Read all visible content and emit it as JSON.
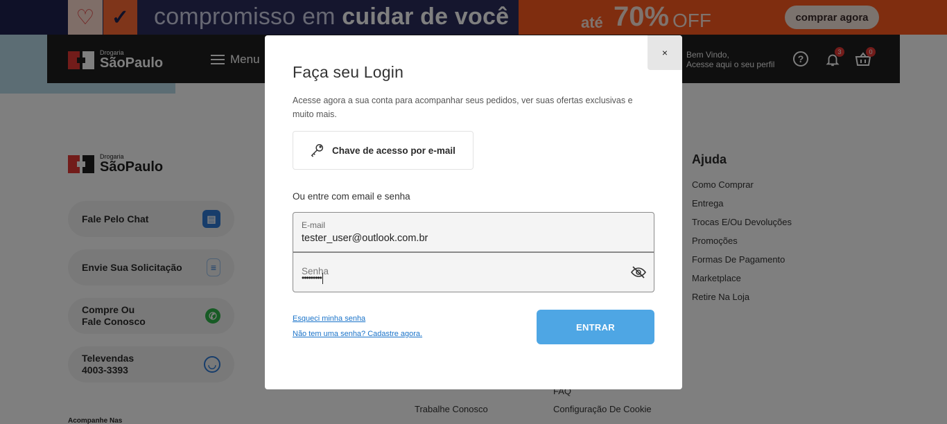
{
  "promo": {
    "headline_light": "compromisso em",
    "headline_bold": "cuidar de você",
    "up_to": "até",
    "percent": "70%",
    "off": "OFF",
    "cta": "comprar agora"
  },
  "header": {
    "brand_small": "Drogaria",
    "brand_name": "SãoPaulo",
    "menu_label": "Menu",
    "welcome_line1": "Bem Vindo,",
    "welcome_line2": "Acesse aqui o seu perfil",
    "notifications_count": "3",
    "cart_count": "0"
  },
  "sidebar": {
    "brand_small": "Drogaria",
    "brand_name": "SãoPaulo",
    "contacts": [
      {
        "line1": "Fale Pelo Chat",
        "line2": ""
      },
      {
        "line1": "Envie Sua Solicitação",
        "line2": ""
      },
      {
        "line1": "Compre Ou",
        "line2": "Fale Conosco"
      },
      {
        "line1": "Televendas",
        "line2": "4003-3393"
      }
    ],
    "follow_label": "Acompanhe Nas"
  },
  "help": {
    "title": "Ajuda",
    "links": [
      "Como Comprar",
      "Entrega",
      "Trocas E/Ou Devoluções",
      "Promoções",
      "Formas De Pagamento",
      "Marketplace",
      "Retire Na Loja"
    ]
  },
  "footer": {
    "faq": "FAQ",
    "work_with_us": "Trabalhe Conosco",
    "cookie_config": "Configuração De Cookie"
  },
  "login_modal": {
    "close_label": "×",
    "title": "Faça seu Login",
    "description": "Acesse agora a sua conta para acompanhar seus pedidos, ver suas ofertas exclusivas e muito mais.",
    "key_access_label": "Chave de acesso por e-mail",
    "alt_label": "Ou entre com email e senha",
    "email_label": "E-mail",
    "email_value": "tester_user@outlook.com.br",
    "password_label": "Senha",
    "password_value": "•••••••••",
    "forgot_password": "Esqueci minha senha",
    "signup": "Não tem uma senha? Cadastre agora.",
    "submit": "ENTRAR"
  },
  "colors": {
    "primary_button": "#4ea6e4",
    "brand_red": "#e53935",
    "promo_orange": "#ff5a1f",
    "link_blue": "#1a73c9"
  }
}
